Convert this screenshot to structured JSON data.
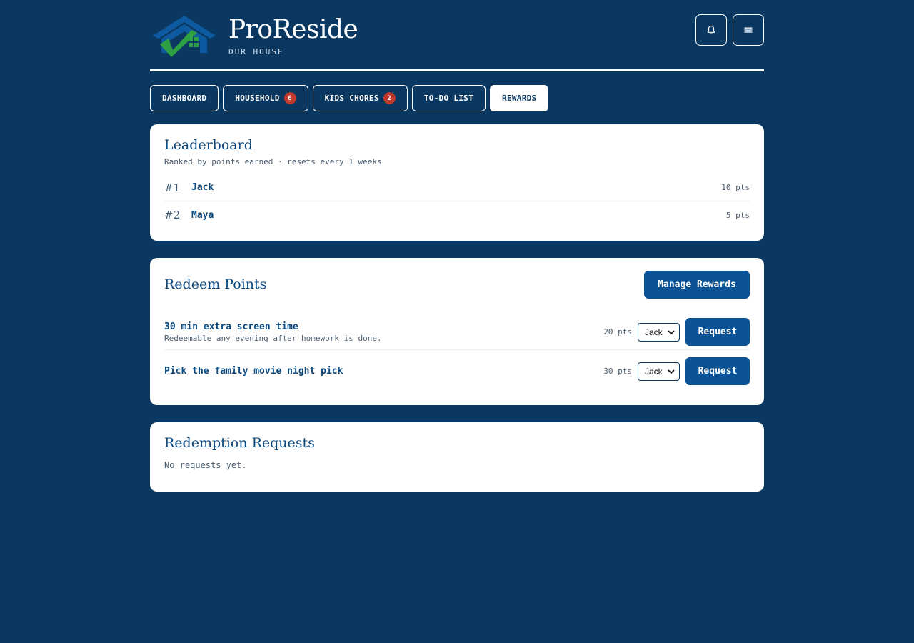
{
  "app": {
    "title": "ProReside",
    "subtitle": "OUR HOUSE"
  },
  "header": {
    "icons": [
      "bell-icon",
      "menu-icon"
    ]
  },
  "tabs": [
    {
      "label": "DASHBOARD",
      "badge": null
    },
    {
      "label": "HOUSEHOLD",
      "badge": "6"
    },
    {
      "label": "KIDS CHORES",
      "badge": "2"
    },
    {
      "label": "TO-DO LIST",
      "badge": null
    },
    {
      "label": "REWARDS",
      "badge": null,
      "active": true
    }
  ],
  "leaderboard": {
    "title": "Leaderboard",
    "subtitle": "Ranked by points earned · resets every 1 weeks",
    "rows": [
      {
        "rank": "#1",
        "name": "Jack",
        "points": "10 pts"
      },
      {
        "rank": "#2",
        "name": "Maya",
        "points": "5 pts"
      }
    ]
  },
  "redeem": {
    "title": "Redeem Points",
    "manage_label": "Manage Rewards",
    "rewards": [
      {
        "title": "30 min extra screen time",
        "description": "Redeemable any evening after homework is done.",
        "points": "20 pts",
        "selected": "Jack",
        "button": "Request"
      },
      {
        "title": "Pick the family movie night pick",
        "description": "",
        "points": "30 pts",
        "selected": "Jack",
        "button": "Request"
      }
    ]
  },
  "requests": {
    "title": "Redemption Requests",
    "empty": "No requests yet."
  },
  "colors": {
    "background": "#0b3861",
    "primary": "#0b5395",
    "badge": "#c0392b",
    "logo_green": "#2ea043"
  }
}
